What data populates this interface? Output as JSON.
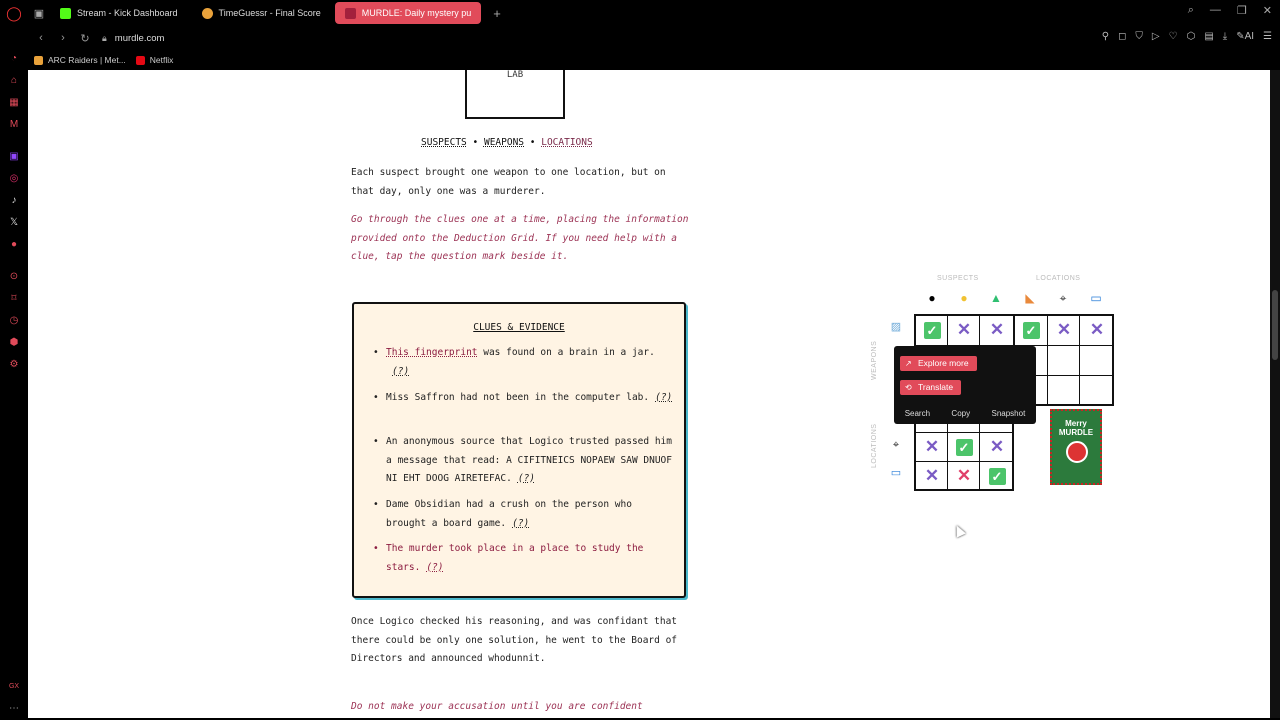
{
  "tabs": [
    {
      "label": "Stream - Kick Dashboard",
      "favicon_color": "#53fc18",
      "active": false
    },
    {
      "label": "TimeGuessr - Final Score",
      "favicon_color": "#e9a23b",
      "active": false
    },
    {
      "label": "MURDLE: Daily mystery pu",
      "favicon_color": "#a3203c",
      "active": true
    }
  ],
  "address": {
    "url": "murdle.com"
  },
  "bookmarks": [
    {
      "label": "ARC Raiders | Met...",
      "favicon_color": "#e9a23b"
    },
    {
      "label": "Netflix",
      "favicon_color": "#e50914"
    }
  ],
  "page": {
    "lab_card": "LAB",
    "categories": {
      "suspects": "SUSPECTS",
      "weapons": "WEAPONS",
      "locations": "LOCATIONS",
      "sep": "•"
    },
    "intro_1": "Each suspect brought one weapon to one location, but on that day, only one was a murderer.",
    "intro_2": "Go through the clues one at a time, placing the information provided onto the Deduction Grid. If you need help with a clue, tap the question mark beside it.",
    "clues_title": "CLUES & EVIDENCE",
    "clues": [
      {
        "link": "This fingerprint",
        "text": " was found on a brain in a jar.",
        "q": "(?)"
      },
      {
        "text": "Miss Saffron had not been in the computer lab.",
        "q": "(?)"
      },
      {
        "text": "An anonymous source that Logico trusted passed him a message that read: A CIFITNEICS NOPAEW SAW DNUOF NI EHT DOOG AIRETEFAC.",
        "q": "(?)"
      },
      {
        "text": "Dame Obsidian had a crush on the person who brought a board game.",
        "q": "(?)"
      },
      {
        "text": "The murder took place in a place to study the stars.",
        "q": "(?)"
      }
    ],
    "outro_1": "Once Logico checked his reasoning, and was confidant that there could be only one solution, he went to the Board of Directors and announced whodunnit.",
    "outro_2": "Do not make your accusation until you are confident"
  },
  "grid": {
    "head_suspects": "SUSPECTS",
    "head_locations": "LOCATIONS",
    "side_weapons": "WEAPONS",
    "side_locations": "LOCATIONS",
    "row1": [
      "check",
      "x",
      "x",
      "check",
      "x",
      "x"
    ],
    "loc_rows": [
      [
        "x",
        "check",
        "x"
      ],
      [
        "x",
        "xred",
        "check"
      ]
    ],
    "symbols": {
      "x": "✕",
      "check": "✓"
    },
    "poster_title": "Merry MURDLE"
  },
  "popup": {
    "explore": "Explore more",
    "translate": "Translate",
    "search": "Search",
    "copy": "Copy",
    "snapshot": "Snapshot"
  }
}
